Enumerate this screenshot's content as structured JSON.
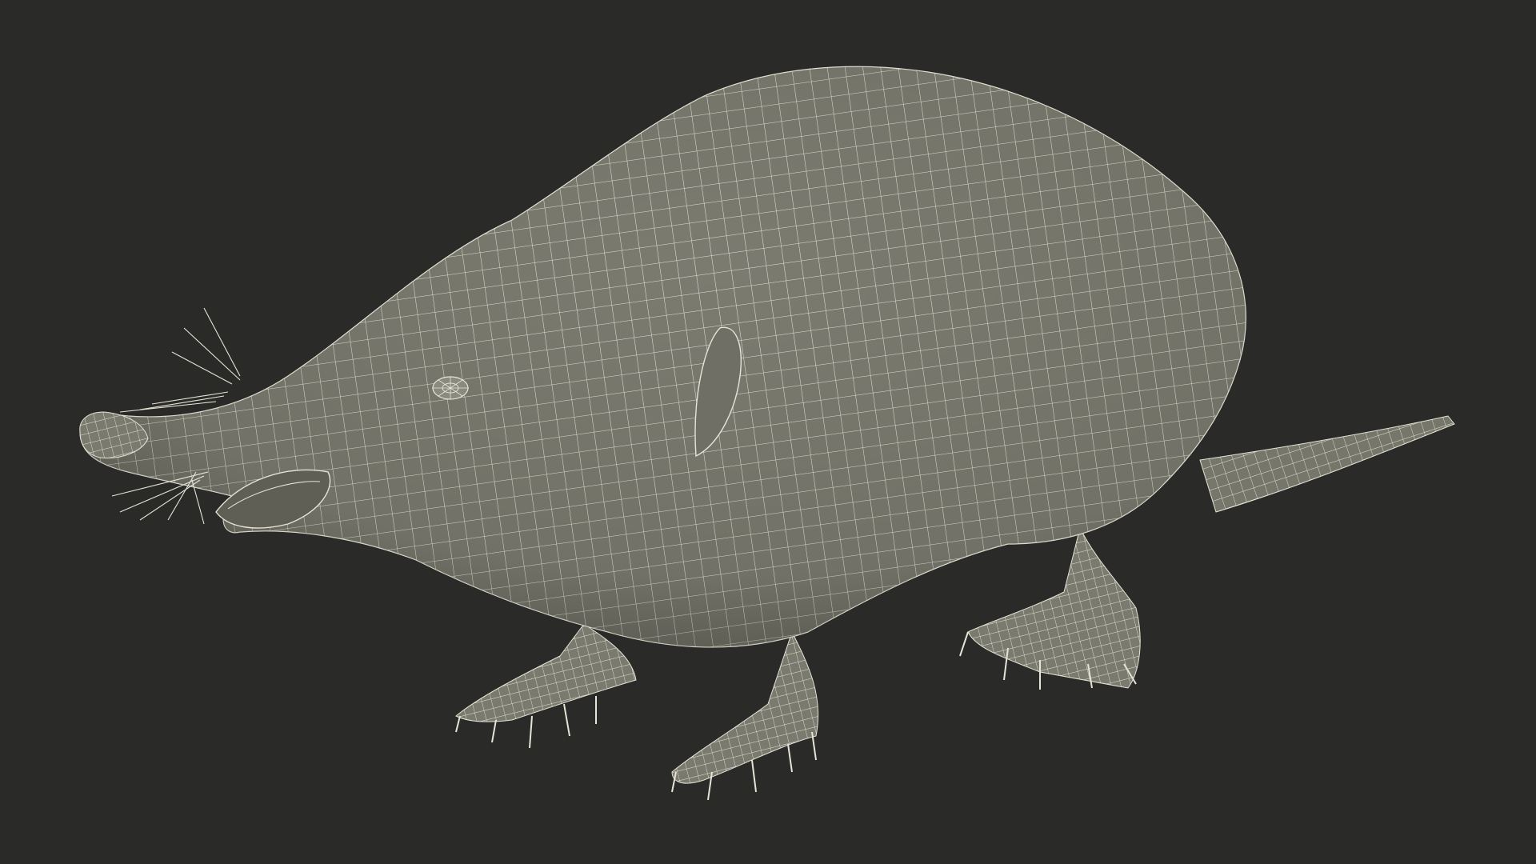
{
  "scene": {
    "background_color": "#2a2a28",
    "mesh_fill_color": "#7b7b70",
    "mesh_shadow_color": "#5e5e55",
    "wire_color": "#e6e4d6",
    "subject": "wireframe-shrew-model"
  }
}
